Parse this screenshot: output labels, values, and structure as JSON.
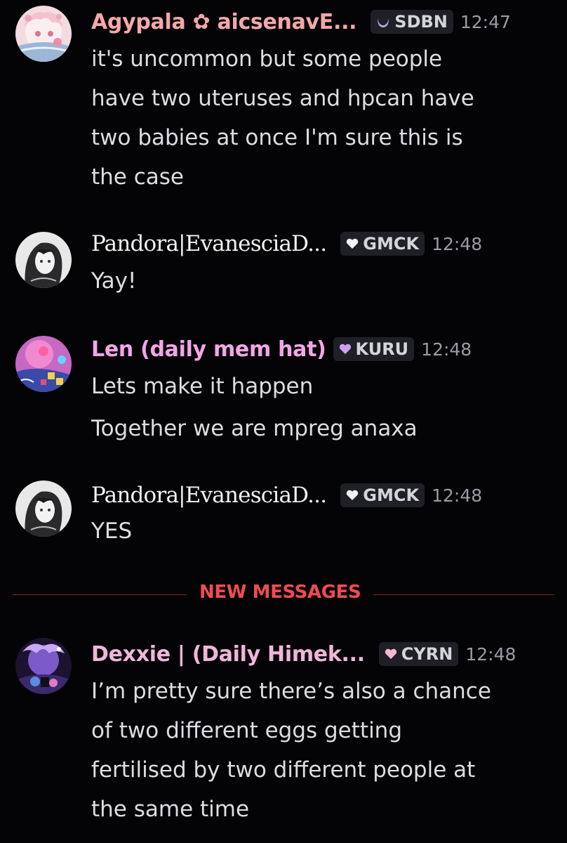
{
  "messages": [
    {
      "author": "Agypala ✿ aicsenavE...",
      "tag": "SDBN",
      "time": "12:47",
      "lines": [
        "it's uncommon but some people",
        "have two uteruses and hpcan have",
        "two babies at once I'm sure this is",
        "the case"
      ],
      "name_color": "#f4a8a8",
      "tag_icon": "moon-icon"
    },
    {
      "author": "Pandora|EvanesciaD...",
      "tag": "GMCK",
      "time": "12:48",
      "lines": [
        "Yay!"
      ],
      "name_color": "#f2f2f2",
      "tag_icon": "heart-icon"
    },
    {
      "author": "Len (daily mem hat)",
      "tag": "KURU",
      "time": "12:48",
      "lines": [
        "Lets make it happen",
        "Together we are mpreg anaxa"
      ],
      "name_color": "#f3a6e6",
      "tag_icon": "heart-icon"
    },
    {
      "author": "Pandora|EvanesciaD...",
      "tag": "GMCK",
      "time": "12:48",
      "lines": [
        "YES"
      ],
      "name_color": "#f2f2f2",
      "tag_icon": "heart-icon"
    },
    {
      "author": "Dexxie | (Daily Himek...",
      "tag": "CYRN",
      "time": "12:48",
      "lines": [
        "I’m pretty sure there’s also a chance",
        "of two different eggs getting",
        "fertilised by two different people at",
        "the same time"
      ],
      "name_color": "#f0b6da",
      "tag_icon": "heart-icon"
    }
  ],
  "divider": {
    "label": "NEW MESSAGES",
    "color": "#f04b51"
  }
}
